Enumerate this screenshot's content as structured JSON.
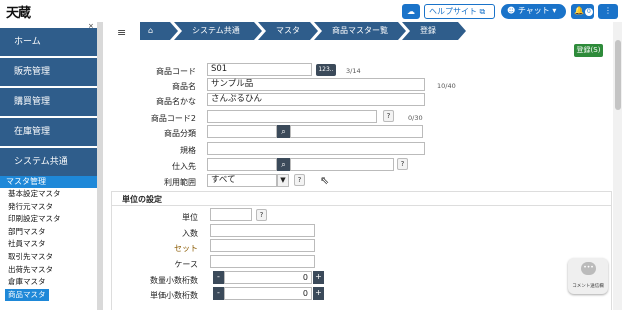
{
  "app": {
    "logo": "天蔵",
    "help_label": "ヘルプサイト",
    "chat_label": "チャット",
    "notify_count": "0"
  },
  "sidebar": {
    "main_items": [
      {
        "label": "ホーム"
      },
      {
        "label": "販売管理"
      },
      {
        "label": "購買管理"
      },
      {
        "label": "在庫管理"
      },
      {
        "label": "システム共通"
      }
    ],
    "sub_header": "マスタ管理",
    "links": [
      "基本設定マスタ",
      "発行元マスタ",
      "印刷設定マスタ",
      "部門マスタ",
      "社員マスタ",
      "取引先マスタ",
      "出荷先マスタ",
      "倉庫マスタ",
      "商品マスタ"
    ],
    "active_link": "商品マスタ",
    "close_icon": "×"
  },
  "breadcrumb": {
    "home_icon": "home-icon",
    "items": [
      "システム共通",
      "マスタ",
      "商品マスター覧",
      "登録"
    ]
  },
  "register_button": "登録(S)",
  "form": {
    "product_code": {
      "label": "商品コード",
      "value": "S01",
      "tag": "123..",
      "count": "3/14"
    },
    "product_name": {
      "label": "商品名",
      "value": "サンプル品",
      "count": "10/40"
    },
    "product_kana": {
      "label": "商品名かな",
      "value": "さんぷるひん"
    },
    "product_code2": {
      "label": "商品コード2",
      "value": "",
      "count": "0/30"
    },
    "category": {
      "label": "商品分類",
      "value": ""
    },
    "spec": {
      "label": "規格",
      "value": ""
    },
    "supplier": {
      "label": "仕入先",
      "value": ""
    },
    "usage_scope": {
      "label": "利用範囲",
      "value": "すべて"
    }
  },
  "unit_section": {
    "title": "単位の設定",
    "unit": {
      "label": "単位",
      "value": ""
    },
    "pieces": {
      "label": "入数",
      "value": ""
    },
    "set": {
      "label": "セット",
      "value": ""
    },
    "case": {
      "label": "ケース",
      "value": ""
    },
    "qty_decimals": {
      "label": "数量小数桁数",
      "value": "0"
    },
    "price_decimals": {
      "label": "単価小数桁数",
      "value": "0"
    }
  },
  "comment_bubble": "コメント送信欄",
  "help_mark": "?",
  "colors": {
    "primary": "#1a73c9",
    "nav": "#2f5d8b",
    "accent": "#1e88d8",
    "success": "#2e8b3a"
  }
}
